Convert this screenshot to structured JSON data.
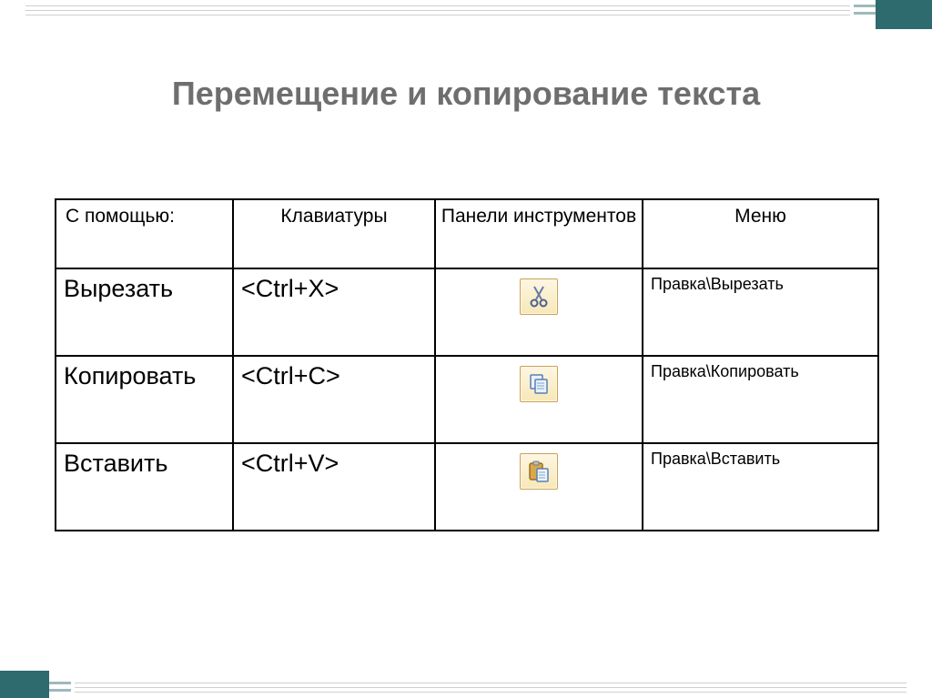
{
  "title": "Перемещение и копирование текста",
  "table": {
    "headers": {
      "with": "С помощью:",
      "keyboard": "Клавиатуры",
      "toolbar": "Панели инструментов",
      "menu": "Меню"
    },
    "rows": [
      {
        "operation": "Вырезать",
        "keyboard": "<Ctrl+X>",
        "icon": "cut-icon",
        "menu": "Правка\\Вырезать"
      },
      {
        "operation": "Копировать",
        "keyboard": "<Ctrl+C>",
        "icon": "copy-icon",
        "menu": "Правка\\Копировать"
      },
      {
        "operation": "Вставить",
        "keyboard": "<Ctrl+V>",
        "icon": "paste-icon",
        "menu": "Правка\\Вставить"
      }
    ]
  }
}
